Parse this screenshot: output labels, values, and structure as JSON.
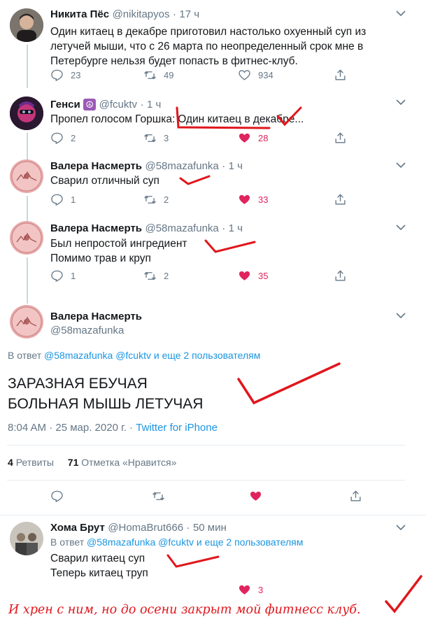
{
  "tweets": [
    {
      "name": "Никита Пёс",
      "handle": "@nikitapyos",
      "sep": "·",
      "time": "17 ч",
      "lines": [
        "Один китаец в декабре приготовил настолько охуенный суп из",
        "летучей мыши, что с 26 марта по неопределенный срок мне в",
        "Петербурге нельзя будет попасть в фитнес-клуб."
      ],
      "replies": "23",
      "retweets": "49",
      "likes": "934"
    },
    {
      "name": "Генси",
      "emoji": "☮",
      "handle": "@fcuktv",
      "sep": "·",
      "time": "1 ч",
      "text_prefix": "Пропел голосом Горшка:",
      "text_quote": "Один китаец в декабре...",
      "replies": "2",
      "retweets": "3",
      "likes": "28"
    },
    {
      "name": "Валера Насмерть",
      "handle": "@58mazafunka",
      "sep": "·",
      "time": "1 ч",
      "lines": [
        "Сварил отличный суп"
      ],
      "replies": "1",
      "retweets": "2",
      "likes": "33"
    },
    {
      "name": "Валера Насмерть",
      "handle": "@58mazafunka",
      "sep": "·",
      "time": "1 ч",
      "lines": [
        "Был непростой ингредиент",
        "Помимо трав и круп"
      ],
      "replies": "1",
      "retweets": "2",
      "likes": "35"
    }
  ],
  "main": {
    "name": "Валера Насмерть",
    "handle": "@58mazafunka",
    "reply_prefix": "В ответ",
    "reply_mentions": "@58mazafunka @fcuktv и еще 2 пользователям",
    "text_lines": [
      "ЗАРАЗНАЯ ЕБУЧАЯ",
      "БОЛЬНАЯ МЫШЬ ЛЕТУЧАЯ"
    ],
    "time": "8:04 AM · 25 мар. 2020 г. ·",
    "source": "Twitter for iPhone",
    "retweets_count": "4",
    "retweets_label": "Ретвиты",
    "likes_count": "71",
    "likes_label": "Отметка «Нравится»"
  },
  "reply": {
    "name": "Хома Брут",
    "handle": "@HomaBrut666",
    "sep": "·",
    "time": "50 мин",
    "reply_prefix": "В ответ",
    "reply_mentions": "@58mazafunka @fcuktv и еще 2 пользователям",
    "lines": [
      "Сварил китаец суп",
      "Теперь китаец труп"
    ],
    "likes": "3"
  },
  "caption": "И хрен с ним, но до осени закрыт мой фитнесс клуб.",
  "colors": {
    "accent": "#1b95e0",
    "like": "#e0245e",
    "muted": "#657786",
    "scribble": "#e0161c"
  }
}
